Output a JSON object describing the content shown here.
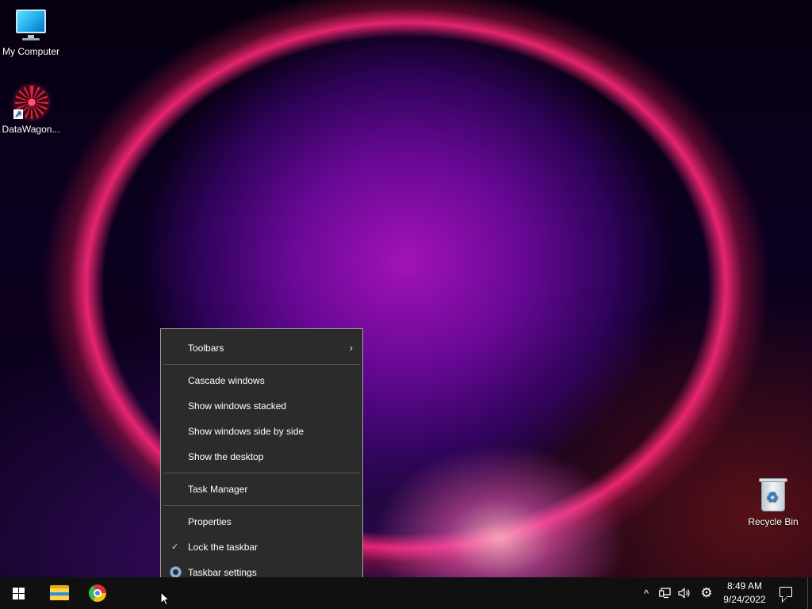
{
  "desktop": {
    "icons": [
      {
        "label": "My Computer",
        "icon": "monitor-icon"
      },
      {
        "label": "DataWagon...",
        "icon": "datawagon-app-icon"
      },
      {
        "label": "Recycle Bin",
        "icon": "recycle-bin-icon"
      }
    ]
  },
  "context_menu": {
    "items": [
      {
        "label": "Toolbars",
        "submenu": true
      },
      {
        "label": "Cascade windows"
      },
      {
        "label": "Show windows stacked"
      },
      {
        "label": "Show windows side by side"
      },
      {
        "label": "Show the desktop"
      },
      {
        "label": "Task Manager"
      },
      {
        "label": "Properties"
      },
      {
        "label": "Lock the taskbar",
        "checked": true
      },
      {
        "label": "Taskbar settings",
        "icon": "gear-icon"
      }
    ],
    "check_glyph": "✓",
    "submenu_glyph": "›"
  },
  "taskbar": {
    "pinned": [
      {
        "icon": "windows-start-icon"
      },
      {
        "icon": "file-explorer-icon"
      },
      {
        "icon": "chrome-icon"
      }
    ],
    "tray": {
      "chevron_glyph": "^",
      "network_icon": "network-icon",
      "volume_icon": "volume-icon",
      "settings_icon": "gear-icon"
    },
    "clock": {
      "time": "8:49 AM",
      "date": "9/24/2022"
    },
    "notification_icon": "action-center-icon"
  }
}
